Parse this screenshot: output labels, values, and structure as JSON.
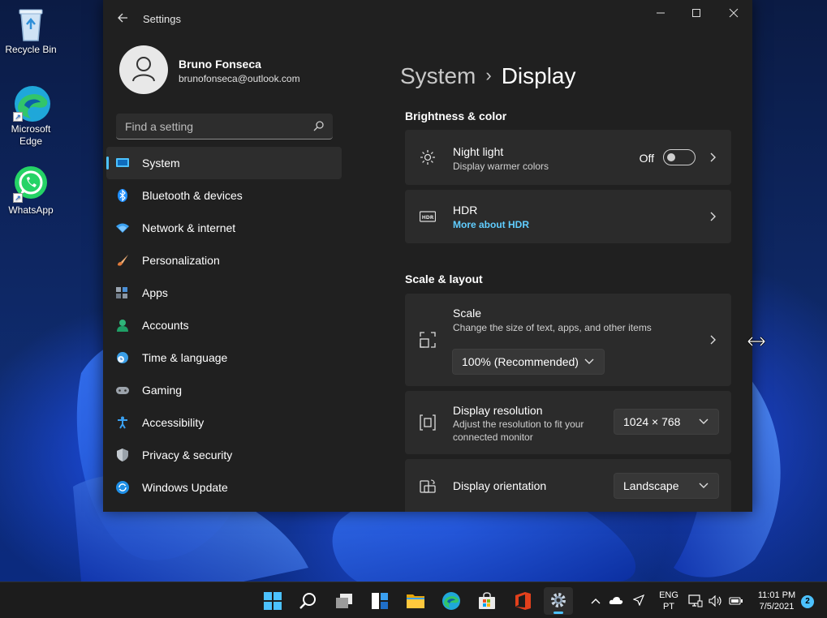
{
  "desktop": {
    "icons": [
      {
        "label": "Recycle Bin",
        "icon": "recycle-bin-icon"
      },
      {
        "label": "Microsoft Edge",
        "icon": "edge-icon"
      },
      {
        "label": "WhatsApp",
        "icon": "whatsapp-icon"
      }
    ]
  },
  "window": {
    "title": "Settings",
    "controls": {
      "minimize": "—",
      "maximize": "☐",
      "close": "✕"
    },
    "back_icon": "back-arrow-icon"
  },
  "profile": {
    "name": "Bruno Fonseca",
    "email": "brunofonseca@outlook.com"
  },
  "search": {
    "placeholder": "Find a setting",
    "icon": "search-icon"
  },
  "nav": {
    "items": [
      {
        "label": "System",
        "icon": "system-icon",
        "active": true
      },
      {
        "label": "Bluetooth & devices",
        "icon": "bluetooth-icon"
      },
      {
        "label": "Network & internet",
        "icon": "wifi-icon"
      },
      {
        "label": "Personalization",
        "icon": "brush-icon"
      },
      {
        "label": "Apps",
        "icon": "apps-icon"
      },
      {
        "label": "Accounts",
        "icon": "accounts-icon"
      },
      {
        "label": "Time & language",
        "icon": "globe-clock-icon"
      },
      {
        "label": "Gaming",
        "icon": "gamepad-icon"
      },
      {
        "label": "Accessibility",
        "icon": "accessibility-icon"
      },
      {
        "label": "Privacy & security",
        "icon": "shield-icon"
      },
      {
        "label": "Windows Update",
        "icon": "update-icon"
      }
    ]
  },
  "breadcrumb": {
    "parent": "System",
    "separator": "›",
    "current": "Display"
  },
  "brightness": {
    "heading": "Brightness & color",
    "night_light": {
      "title": "Night light",
      "subtitle": "Display warmer colors",
      "state": "Off",
      "on": false
    },
    "hdr": {
      "title": "HDR",
      "link": "More about HDR"
    }
  },
  "scale_layout": {
    "heading": "Scale & layout",
    "scale": {
      "title": "Scale",
      "subtitle": "Change the size of text, apps, and other items",
      "value": "100% (Recommended)"
    },
    "resolution": {
      "title": "Display resolution",
      "subtitle_line1": "Adjust the resolution to fit your",
      "subtitle_line2": "connected monitor",
      "value": "1024 × 768"
    },
    "orientation": {
      "title": "Display orientation",
      "value": "Landscape"
    }
  },
  "taskbar": {
    "apps": [
      "start-icon",
      "search-icon",
      "task-view-icon",
      "widgets-icon",
      "file-explorer-icon",
      "edge-icon",
      "store-icon",
      "office-icon",
      "settings-icon"
    ],
    "language_line1": "ENG",
    "language_line2": "PT",
    "time": "11:01 PM",
    "date": "7/5/2021",
    "notification_count": "2",
    "accent": "#4cc2ff"
  }
}
